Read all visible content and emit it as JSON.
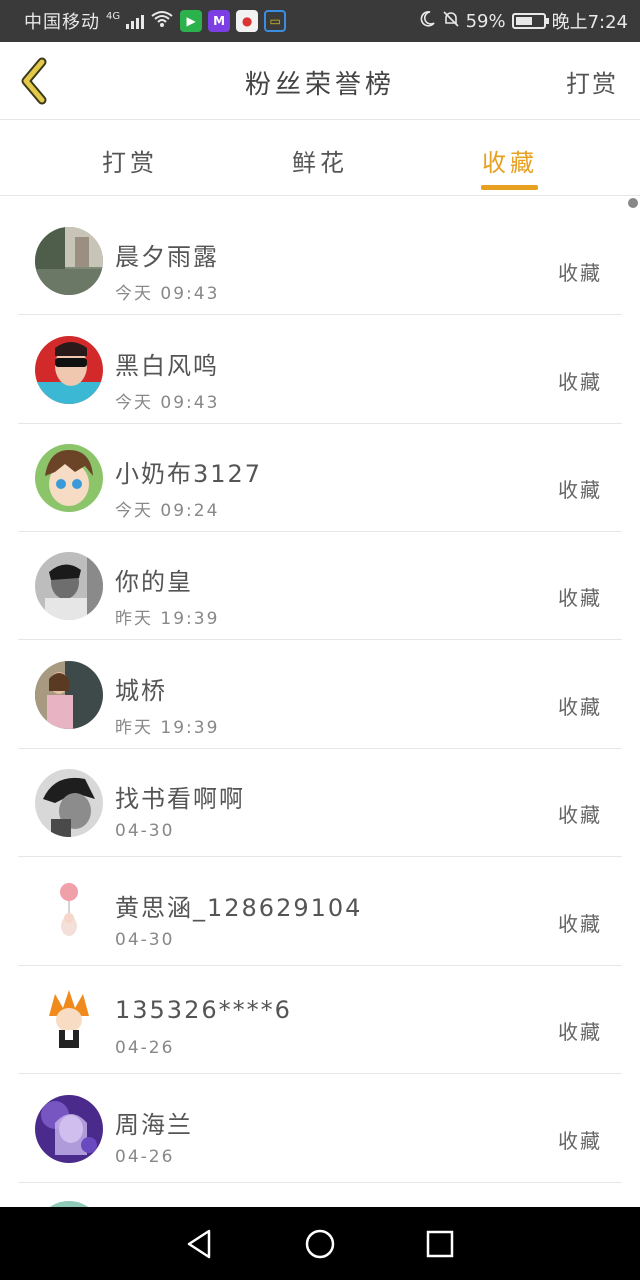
{
  "status_bar": {
    "carrier": "中国移动",
    "network": "4G",
    "battery_percent": "59%",
    "time": "晚上7:24"
  },
  "header": {
    "title": "粉丝荣誉榜",
    "action": "打赏"
  },
  "tabs": [
    {
      "label": "打赏",
      "active": false
    },
    {
      "label": "鲜花",
      "active": false
    },
    {
      "label": "收藏",
      "active": true
    }
  ],
  "accent_color": "#e8a020",
  "items": [
    {
      "name": "晨夕雨露",
      "time": "今天 09:43",
      "action": "收藏",
      "avatar": "garden-photo"
    },
    {
      "name": "黑白风鸣",
      "time": "今天 09:43",
      "action": "收藏",
      "avatar": "sunglasses-photo"
    },
    {
      "name": "小奶布3127",
      "time": "今天 09:24",
      "action": "收藏",
      "avatar": "anime-boy"
    },
    {
      "name": "你的皇",
      "time": "昨天 19:39",
      "action": "收藏",
      "avatar": "bw-portrait"
    },
    {
      "name": "城桥",
      "time": "昨天 19:39",
      "action": "收藏",
      "avatar": "girl-photo"
    },
    {
      "name": "找书看啊啊",
      "time": "04-30",
      "action": "收藏",
      "avatar": "bw-closeup"
    },
    {
      "name": "黄思涵_128629104",
      "time": "04-30",
      "action": "收藏",
      "avatar": "balloon-figure"
    },
    {
      "name": "135326****6",
      "time": "04-26",
      "action": "收藏",
      "avatar": "chibi-character"
    },
    {
      "name": "周海兰",
      "time": "04-26",
      "action": "收藏",
      "avatar": "purple-anime"
    }
  ]
}
